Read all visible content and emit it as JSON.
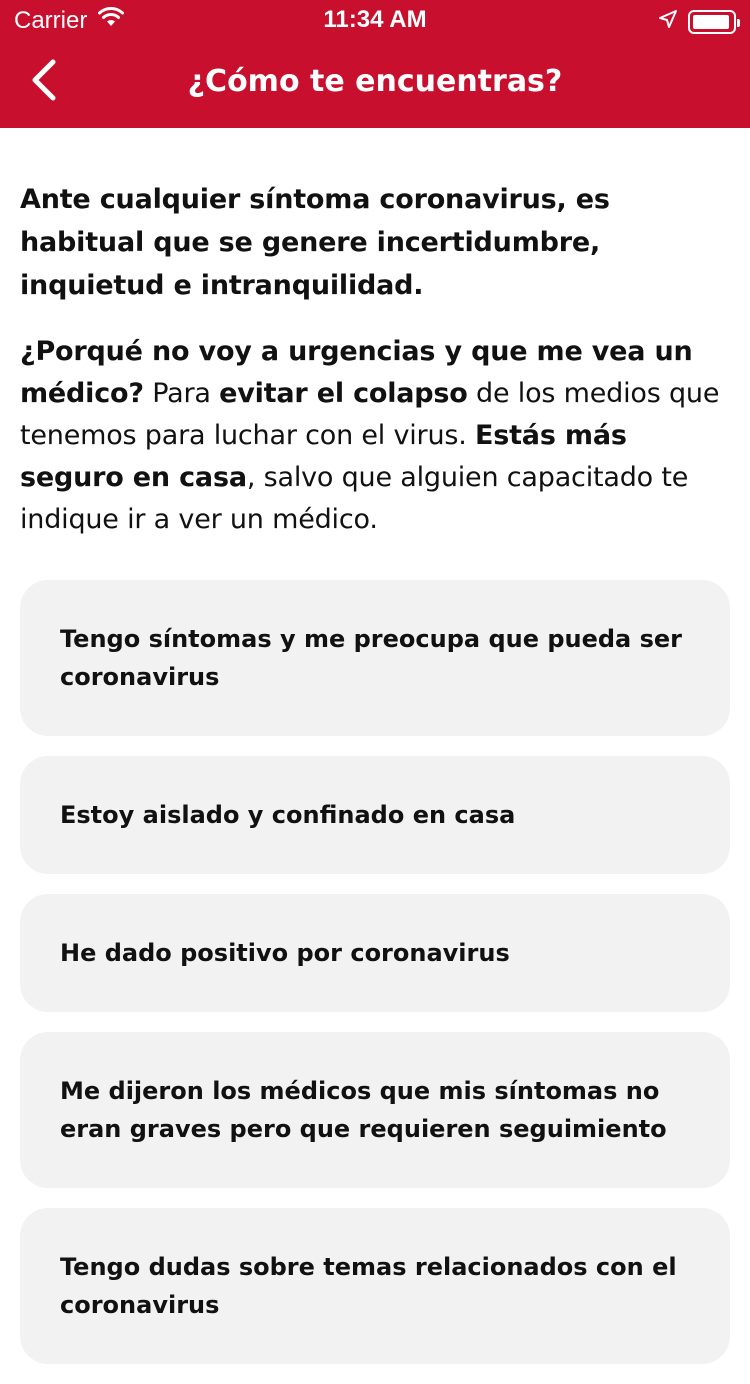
{
  "status_bar": {
    "carrier": "Carrier",
    "time": "11:34 AM",
    "battery_level": 0.95,
    "icons": [
      "wifi-icon",
      "location-arrow-icon",
      "battery-icon"
    ]
  },
  "nav": {
    "back_icon": "chevron-left-icon",
    "title": "¿Cómo te encuentras?"
  },
  "content": {
    "intro": "Ante cualquier síntoma coronavirus, es habitual que se genere incertidumbre, inquietud e intranquilidad.",
    "paragraph": {
      "question": "¿Porqué no voy a urgencias y que me vea un médico?",
      "text1": " Para ",
      "emphasis1": "evitar el colapso",
      "text2": " de los medios que tenemos para luchar con el virus. ",
      "emphasis2": "Estás más seguro en casa",
      "text3": ", salvo que alguien capacitado te indique ir a ver un médico."
    }
  },
  "options": [
    "Tengo síntomas y me preocupa que pueda ser coronavirus",
    "Estoy aislado y confinado en casa",
    "He dado positivo por coronavirus",
    "Me dijeron los médicos que mis síntomas no eran graves pero que requieren seguimiento",
    "Tengo dudas sobre temas relacionados con el coronavirus"
  ],
  "colors": {
    "brand_red": "#c8102e",
    "option_bg": "#f2f2f2",
    "text": "#111111"
  }
}
